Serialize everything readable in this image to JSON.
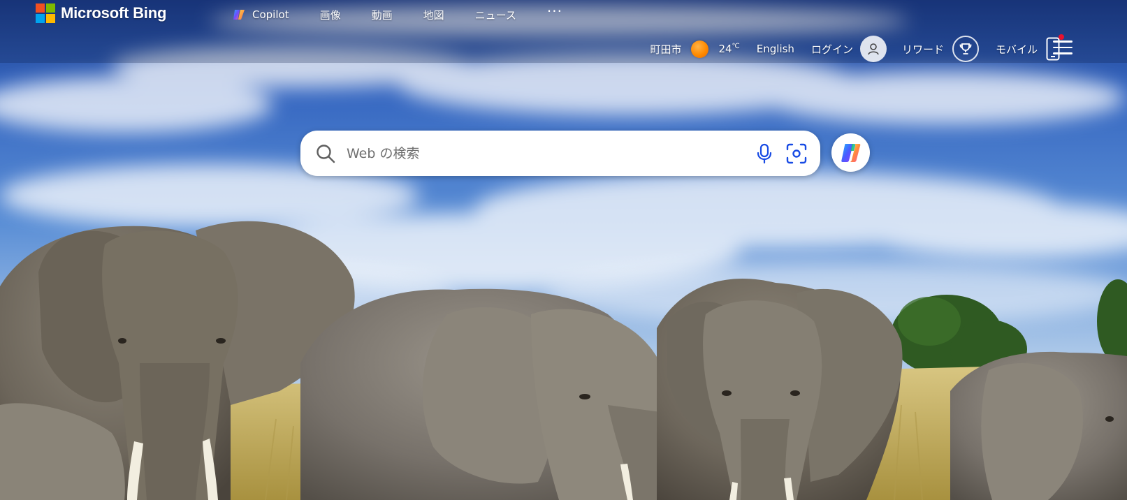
{
  "brand": {
    "name": "Microsoft Bing",
    "logo_colors": [
      "#f25022",
      "#7fba00",
      "#00a4ef",
      "#ffb900"
    ]
  },
  "nav": {
    "items": [
      {
        "label": "Copilot",
        "icon": "copilot-icon"
      },
      {
        "label": "画像"
      },
      {
        "label": "動画"
      },
      {
        "label": "地図"
      },
      {
        "label": "ニュース"
      }
    ],
    "more_label": "···"
  },
  "header": {
    "location": "町田市",
    "weather_icon": "sun-icon",
    "temperature": "24",
    "temperature_unit": "℃",
    "language": "English",
    "login_label": "ログイン",
    "rewards_label": "リワード",
    "mobile_label": "モバイル"
  },
  "search": {
    "placeholder": "Web の検索",
    "value": "",
    "mic_icon": "microphone-icon",
    "visual_search_icon": "visual-search-icon"
  },
  "copilot_button": {
    "icon": "copilot-icon"
  },
  "background": {
    "description_icon": "elephants-landscape-image",
    "sky_color": "#3f6fc4",
    "grass_color": "#c9b46a"
  }
}
